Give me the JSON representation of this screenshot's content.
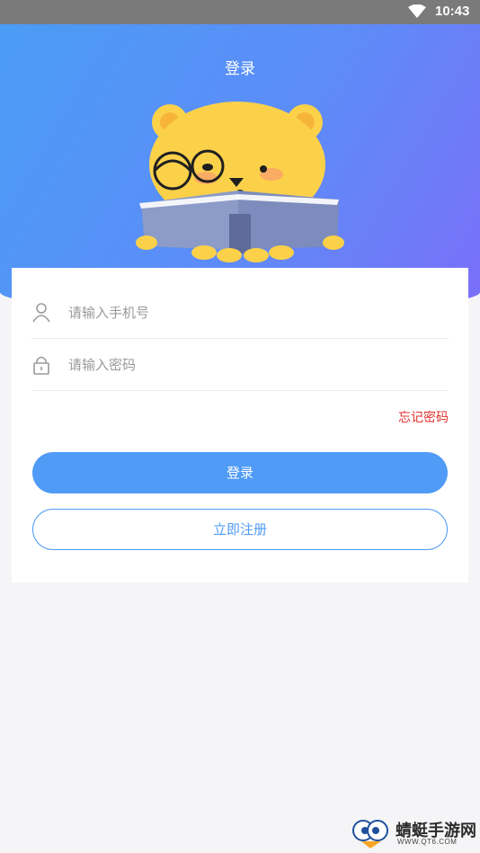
{
  "status_bar": {
    "time": "10:43",
    "wifi_icon": "wifi-icon"
  },
  "header": {
    "title": "登录",
    "mascot": "bear-reading-book-illustration"
  },
  "form": {
    "phone": {
      "placeholder": "请输入手机号",
      "icon": "user-icon"
    },
    "password": {
      "placeholder": "请输入密码",
      "icon": "lock-icon"
    },
    "forgot_label": "忘记密码",
    "login_label": "登录",
    "register_label": "立即注册"
  },
  "colors": {
    "header_gradient_start": "#4a9cf6",
    "header_gradient_end": "#7a6ff8",
    "primary": "#4f9bf6",
    "forgot": "#e0332f",
    "background": "#f5f5f7"
  },
  "watermark": {
    "name": "蜻蜓手游网",
    "url": "WWW.QT6.COM"
  }
}
